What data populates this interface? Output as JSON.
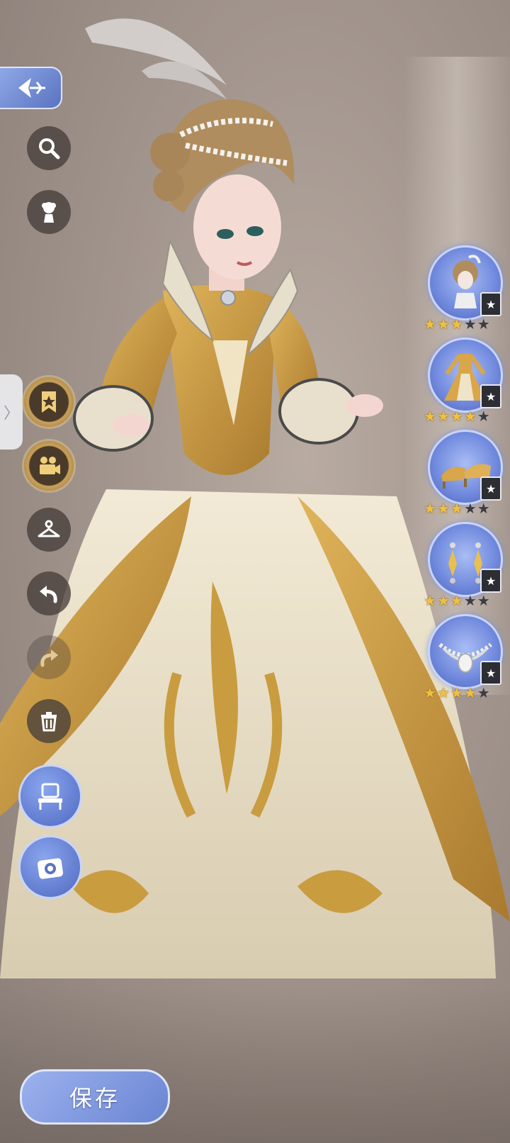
{
  "toolbar": {
    "back": "back-icon",
    "search": "search-icon",
    "style": "flower-bust-icon",
    "favorite": "bookmark-star-icon",
    "record": "camera-recorder-icon",
    "outfit": "hanger-person-icon",
    "undo": "undo-icon",
    "redo": "redo-icon",
    "delete": "trash-icon",
    "vanity": "vanity-mirror-icon",
    "photo": "camera-icon"
  },
  "items": [
    {
      "icon": "hairstyle-icon",
      "stars_on": 3,
      "stars_total": 5,
      "rank": "★"
    },
    {
      "icon": "dress-icon",
      "stars_on": 4,
      "stars_total": 5,
      "rank": "★"
    },
    {
      "icon": "shoes-icon",
      "stars_on": 3,
      "stars_total": 5,
      "rank": "★"
    },
    {
      "icon": "earrings-icon",
      "stars_on": 3,
      "stars_total": 5,
      "rank": "★"
    },
    {
      "icon": "necklace-icon",
      "stars_on": 4,
      "stars_total": 5,
      "rank": "★"
    }
  ],
  "save_label": "保存",
  "side_tab_glyph": "〉",
  "colors": {
    "accent_blue": "#6a84d2",
    "gold": "#c9a15a",
    "star": "#f0c040"
  }
}
